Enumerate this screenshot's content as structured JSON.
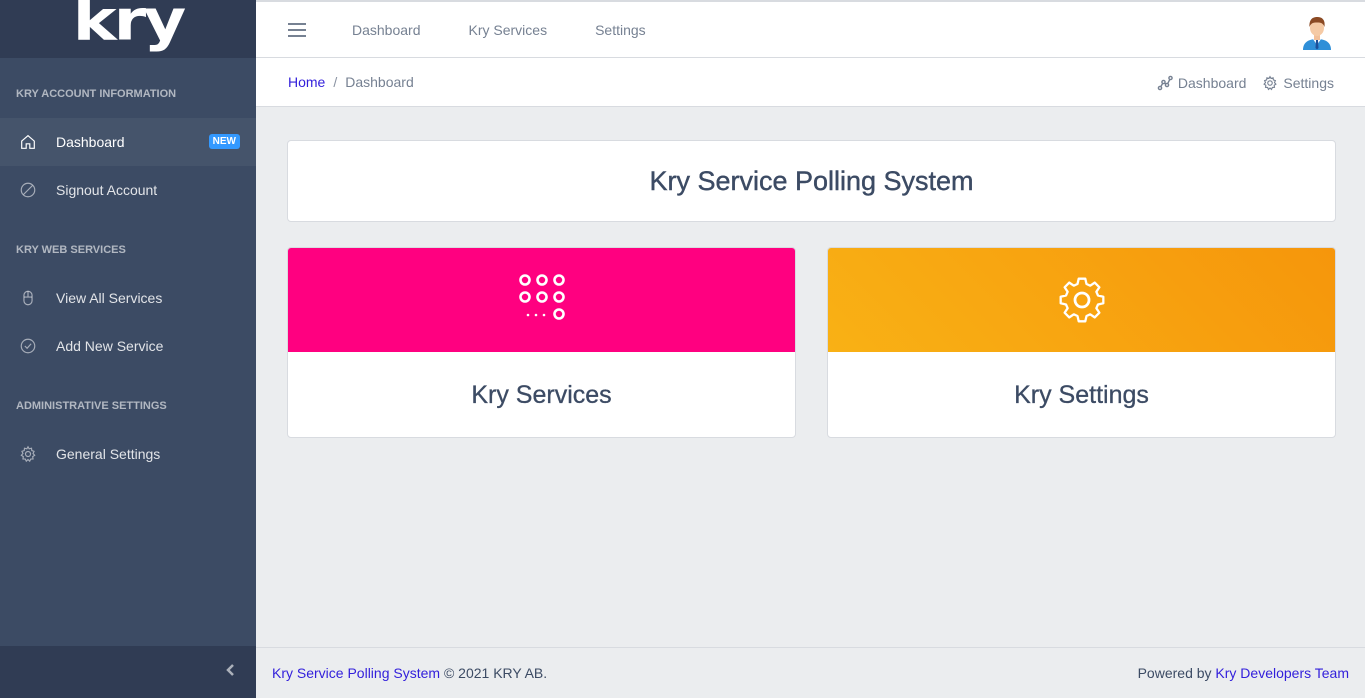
{
  "brand": {
    "logo_text": "kry"
  },
  "sidebar": {
    "sections": [
      {
        "title": "KRY ACCOUNT INFORMATION",
        "items": [
          {
            "label": "Dashboard",
            "icon": "home-icon",
            "badge": "NEW",
            "active": true
          },
          {
            "label": "Signout Account",
            "icon": "ban-icon"
          }
        ]
      },
      {
        "title": "KRY WEB SERVICES",
        "items": [
          {
            "label": "View All Services",
            "icon": "mouse-icon"
          },
          {
            "label": "Add New Service",
            "icon": "check-circle-icon"
          }
        ]
      },
      {
        "title": "ADMINISTRATIVE SETTINGS",
        "items": [
          {
            "label": "General Settings",
            "icon": "gear-icon"
          }
        ]
      }
    ],
    "toggler_icon": "chevron-left-icon"
  },
  "header": {
    "menu_icon": "hamburger-icon",
    "nav": [
      "Dashboard",
      "Kry Services",
      "Settings"
    ],
    "avatar_icon": "user-avatar-icon"
  },
  "subheader": {
    "breadcrumb": {
      "home": "Home",
      "current": "Dashboard"
    },
    "links": [
      {
        "label": "Dashboard",
        "icon": "graph-icon"
      },
      {
        "label": "Settings",
        "icon": "gear-icon"
      }
    ]
  },
  "main": {
    "title": "Kry Service Polling System",
    "tiles": [
      {
        "label": "Kry Services",
        "icon": "dialpad-icon",
        "color": "#ff0080"
      },
      {
        "label": "Kry Settings",
        "icon": "gear-icon",
        "color": "#f9b115"
      }
    ]
  },
  "footer": {
    "left_link": "Kry Service Polling System",
    "left_text": "© 2021 KRY AB.",
    "right_text": "Powered by",
    "right_link": "Kry Developers Team"
  }
}
